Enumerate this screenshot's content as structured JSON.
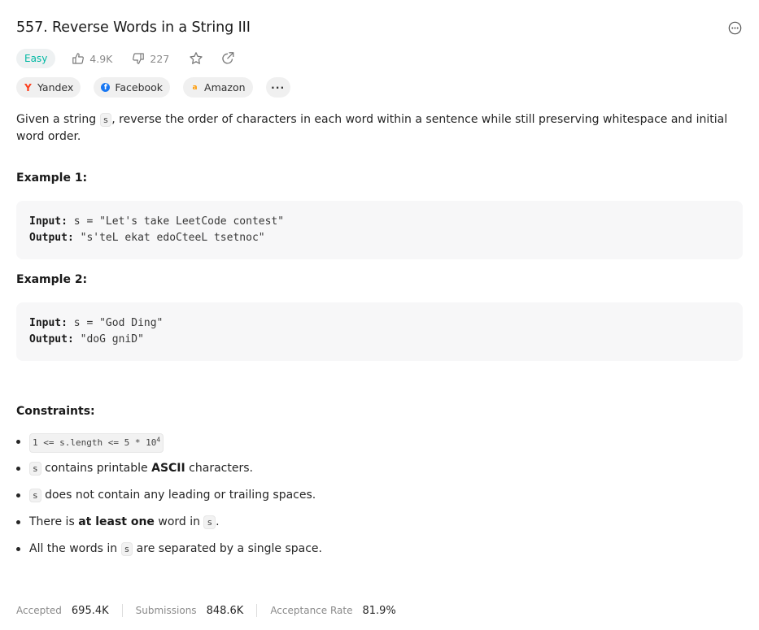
{
  "problem": {
    "title": "557. Reverse Words in a String III",
    "difficulty": "Easy",
    "likes": "4.9K",
    "dislikes": "227"
  },
  "companies": [
    {
      "name": "Yandex",
      "logo": "yandex-logo"
    },
    {
      "name": "Facebook",
      "logo": "facebook-logo"
    },
    {
      "name": "Amazon",
      "logo": "amazon-logo"
    }
  ],
  "more_tags_label": "···",
  "description": {
    "part1": "Given a string ",
    "code": "s",
    "part2": ", reverse the order of characters in each word within a sentence while still preserving whitespace and initial word order."
  },
  "examples": [
    {
      "title": "Example 1:",
      "input_label": "Input:",
      "input": "s = \"Let's take LeetCode contest\"",
      "output_label": "Output:",
      "output": "\"s'teL ekat edoCteeL tsetnoc\""
    },
    {
      "title": "Example 2:",
      "input_label": "Input:",
      "input": "s = \"God Ding\"",
      "output_label": "Output:",
      "output": "\"doG gniD\""
    }
  ],
  "constraints": {
    "title": "Constraints:",
    "c1_code": "1 <= s.length <= 5 * 10",
    "c1_sup": "4",
    "c2_code": "s",
    "c2_text": " contains printable ",
    "c2_bold": "ASCII",
    "c2_tail": " characters.",
    "c3_code": "s",
    "c3_text": " does not contain any leading or trailing spaces.",
    "c4_text": "There is ",
    "c4_bold": "at least one",
    "c4_mid": " word in ",
    "c4_code": "s",
    "c4_tail": ".",
    "c5_text": "All the words in ",
    "c5_code": "s",
    "c5_tail": " are separated by a single space."
  },
  "stats": {
    "accepted_label": "Accepted",
    "accepted": "695.4K",
    "submissions_label": "Submissions",
    "submissions": "848.6K",
    "rate_label": "Acceptance Rate",
    "rate": "81.9%"
  },
  "colors": {
    "easy": "#00b8a3",
    "muted": "#8a8a8a"
  }
}
